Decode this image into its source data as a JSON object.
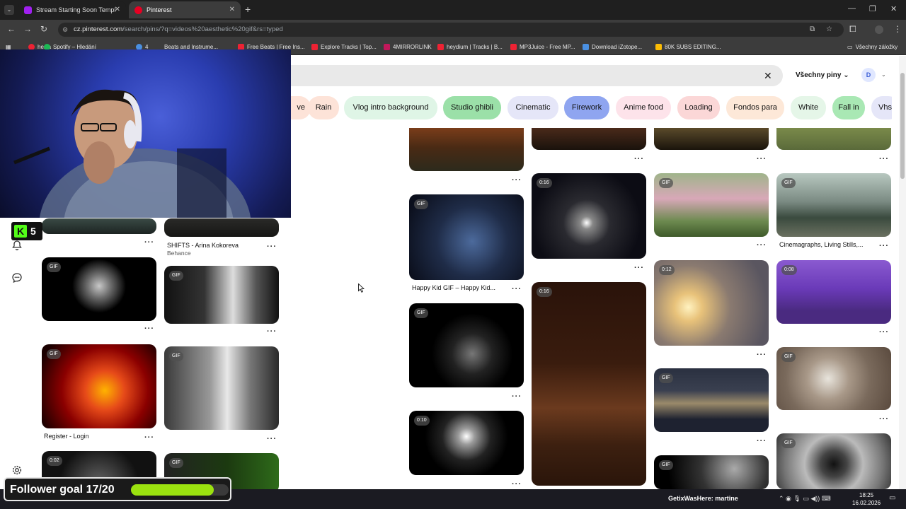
{
  "browser": {
    "tabs": [
      {
        "label": "Stream Starting Soon Template",
        "favicon_color": "#a020f0"
      },
      {
        "label": "Pinterest",
        "favicon_color": "#e60023"
      }
    ],
    "new_tab": "+",
    "window_controls": [
      "—",
      "❐",
      "✕"
    ],
    "url_host": "cz.pinterest.com",
    "url_path": "/search/pins/?q=videos%20aesthetic%20gif&rs=typed",
    "bookmarks": [
      {
        "label": "hesla",
        "color": "#e23"
      },
      {
        "label": "Spotify – Hledání",
        "color": "#1db954"
      },
      {
        "label": "4",
        "color": "#e23"
      },
      {
        "label": "Beats and Instrume...",
        "color": "#888"
      },
      {
        "label": "Free Beats | Free Ins...",
        "color": "#e23"
      },
      {
        "label": "Explore Tracks | Top...",
        "color": "#e23"
      },
      {
        "label": "4MIRRORLINK",
        "color": "#c2185b"
      },
      {
        "label": "heydium | Tracks | B...",
        "color": "#e23"
      },
      {
        "label": "MP3Juice - Free MP...",
        "color": "#e23"
      },
      {
        "label": "Download iZotope...",
        "color": "#4a90e2"
      },
      {
        "label": "80K SUBS EDITING...",
        "color": "#fbbc04"
      }
    ],
    "bookmarks_folder": "Všechny záložky"
  },
  "pinterest": {
    "search_value": "",
    "filter_label": "Všechny piny",
    "avatar_initial": "D",
    "chips": [
      {
        "label": "ve",
        "color": "#fde3d8"
      },
      {
        "label": "Rain",
        "color": "#fde3d8"
      },
      {
        "label": "Vlog intro background",
        "color": "#dff5e6"
      },
      {
        "label": "Studio ghibli",
        "color": "#9be0a8"
      },
      {
        "label": "Cinematic",
        "color": "#e5e6f8"
      },
      {
        "label": "Firework",
        "color": "#8fa5f0"
      },
      {
        "label": "Anime food",
        "color": "#fde3ea"
      },
      {
        "label": "Loading",
        "color": "#fbd7d7"
      },
      {
        "label": "Fondos para",
        "color": "#fde8d8"
      },
      {
        "label": "White",
        "color": "#e5f6e8"
      },
      {
        "label": "Fall in",
        "color": "#a9e8b4"
      },
      {
        "label": "Vhs",
        "color": "#e5e6f8"
      }
    ],
    "pins": {
      "col1": [
        {
          "badge": "GIF"
        },
        {
          "badge": "GIF",
          "caption": "Register - Login"
        },
        {
          "badge": "0:02"
        }
      ],
      "col2": [
        {
          "caption": "SHIFTS - Arina Kokoreva",
          "subcaption": "Behance"
        },
        {
          "badge": "GIF"
        },
        {
          "badge": "GIF"
        },
        {
          "badge": "GIF"
        }
      ],
      "col3": [
        {
          "badge": "GIF",
          "caption": "Happy Kid GIF – Happy Kid..."
        },
        {
          "badge": "GIF"
        },
        {
          "badge": "0:10"
        }
      ],
      "col4": [
        {
          "badge": "0:16"
        },
        {
          "badge": "0:16"
        }
      ],
      "col5": [
        {
          "badge": "GIF"
        },
        {
          "badge": "0:12"
        },
        {
          "badge": "GIF"
        },
        {
          "badge": "GIF"
        }
      ],
      "col6": [
        {
          "badge": "GIF",
          "caption": "Cinemagraphs, Living Stills,..."
        },
        {
          "badge": "0:08"
        },
        {
          "badge": "GIF"
        },
        {
          "badge": "GIF"
        }
      ]
    },
    "more_dots": "···"
  },
  "overlay": {
    "kick_count": "5",
    "kick_logo": "K",
    "follower_goal_label": "Follower goal 17/20",
    "follower_current": 17,
    "follower_target": 20
  },
  "taskbar": {
    "notification": "GetixWasHere: martine",
    "time": "18:25",
    "date": "16.02.2026"
  }
}
